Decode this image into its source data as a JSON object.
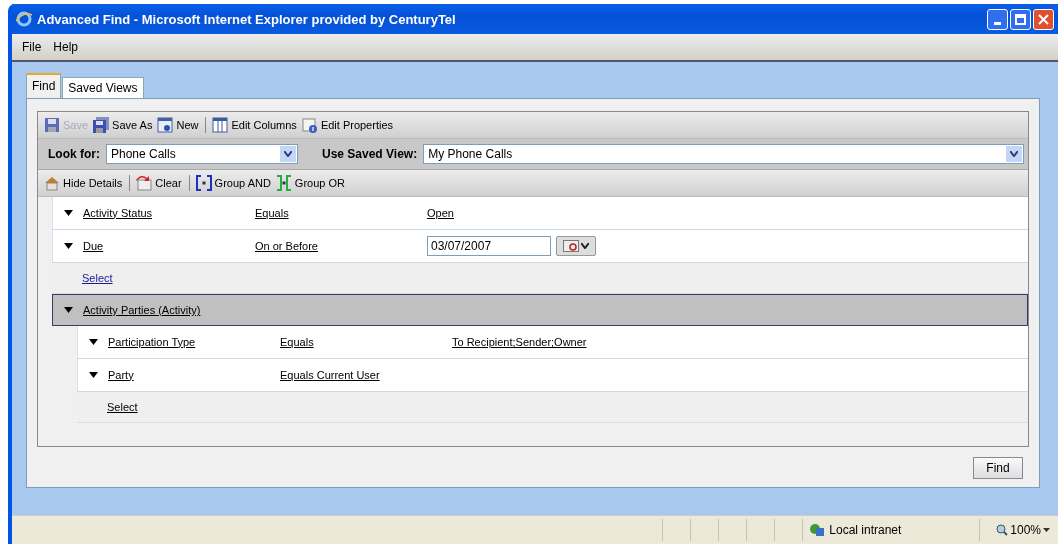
{
  "window": {
    "title": "Advanced Find - Microsoft Internet Explorer provided by CenturyTel"
  },
  "menu": [
    "File",
    "Help"
  ],
  "tabs": [
    {
      "label": "Find",
      "selected": true
    },
    {
      "label": "Saved Views",
      "selected": false
    }
  ],
  "toolbar": [
    {
      "kind": "button",
      "label": "Save",
      "disabled": true
    },
    {
      "kind": "button",
      "label": "Save As",
      "disabled": false
    },
    {
      "kind": "button",
      "label": "New",
      "disabled": false
    },
    {
      "kind": "separator"
    },
    {
      "kind": "button",
      "label": "Edit Columns",
      "disabled": false
    },
    {
      "kind": "button",
      "label": "Edit Properties",
      "disabled": false
    }
  ],
  "look_for": {
    "label": "Look for:",
    "value": "Phone Calls"
  },
  "saved_view": {
    "label": "Use Saved View:",
    "value": "My Phone Calls"
  },
  "criteria_toolbar": [
    {
      "kind": "button",
      "label": "Hide Details"
    },
    {
      "kind": "separator"
    },
    {
      "kind": "button",
      "label": "Clear"
    },
    {
      "kind": "separator"
    },
    {
      "kind": "button",
      "label": "Group AND"
    },
    {
      "kind": "button",
      "label": "Group OR"
    }
  ],
  "conditions": [
    {
      "kind": "text",
      "field": "Activity Status",
      "operator": "Equals",
      "value": "Open"
    },
    {
      "kind": "date",
      "field": "Due",
      "operator": "On or Before",
      "value": "03/07/2007"
    }
  ],
  "select_link": "Select",
  "related": {
    "label": "Activity Parties (Activity)",
    "expanded": true,
    "conditions": [
      {
        "kind": "text",
        "field": "Participation Type",
        "operator": "Equals",
        "value": "To Recipient;Sender;Owner"
      },
      {
        "kind": "text",
        "field": "Party",
        "operator": "Equals Current User"
      }
    ],
    "select_link": "Select"
  },
  "find_button": "Find",
  "status_bar": {
    "zone": "Local intranet",
    "zoom": "100%"
  }
}
